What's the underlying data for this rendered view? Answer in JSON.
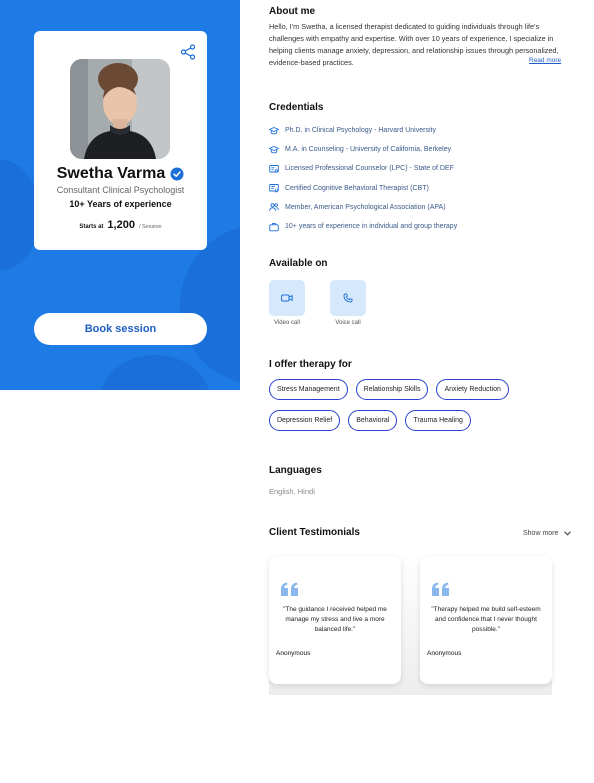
{
  "profile": {
    "name": "Swetha Varma",
    "role": "Consultant Clinical Psychologist",
    "experience": "10+ Years of experience",
    "starts_at_label": "Starts at",
    "price": "1,200",
    "per_session": "/ Session",
    "book_label": "Book session"
  },
  "about": {
    "title": "About me",
    "text": "Hello, I'm Swetha, a licensed therapist dedicated to guiding individuals through life's challenges with empathy and expertise. With over 10 years of experience, I specialize in helping clients manage anxiety, depression, and relationship issues through personalized, evidence-based practices.",
    "read_more": "Read more"
  },
  "credentials": {
    "title": "Credentials",
    "items": [
      {
        "icon": "graduation-cap-icon",
        "label": "Ph.D. in Clinical Psychology - Harvard University"
      },
      {
        "icon": "graduation-cap-icon",
        "label": "M.A. in Counseling - University of California, Berkeley"
      },
      {
        "icon": "license-card-icon",
        "label": "Licensed Professional Counselor (LPC) - State of DEF"
      },
      {
        "icon": "certificate-icon",
        "label": "Certified Cognitive Behavioral Therapist (CBT)"
      },
      {
        "icon": "people-icon",
        "label": "Member, American Psychological Association (APA)"
      },
      {
        "icon": "briefcase-icon",
        "label": "10+ years of experience in individual and group therapy"
      }
    ]
  },
  "available": {
    "title": "Available on",
    "video_label": "Video call",
    "voice_label": "Voice call"
  },
  "therapy": {
    "title": "I offer therapy for",
    "row1": [
      "Stress Management",
      "Relationship Skills",
      "Anxiety Reduction"
    ],
    "row2": [
      "Depression Relief",
      "Behavioral",
      "Trauma Healing"
    ]
  },
  "languages": {
    "title": "Languages",
    "text": "English, Hindi"
  },
  "testimonials": {
    "title": "Client Testimonials",
    "show_more": "Show more",
    "items": [
      {
        "quote": "\"The guidance I received helped me manage my stress and live a more balanced life.\"",
        "author": "Anonymous"
      },
      {
        "quote": "\"Therapy helped me build self-esteem and confidence that I never thought possible.\"",
        "author": "Anonymous"
      }
    ]
  },
  "colors": {
    "brand_blue": "#1e7be6",
    "button_text": "#1d5fc4",
    "tag_border": "#2a3fd0",
    "channel_bg": "#d6e8fb"
  }
}
